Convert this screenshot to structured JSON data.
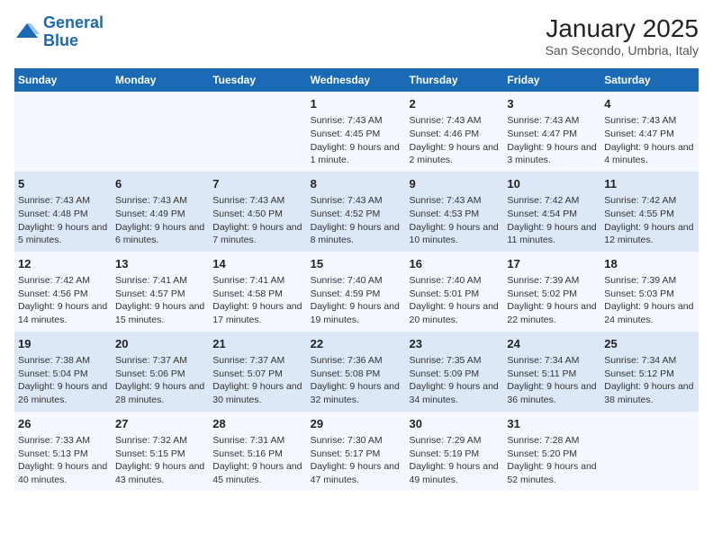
{
  "header": {
    "logo_line1": "General",
    "logo_line2": "Blue",
    "month": "January 2025",
    "location": "San Secondo, Umbria, Italy"
  },
  "weekdays": [
    "Sunday",
    "Monday",
    "Tuesday",
    "Wednesday",
    "Thursday",
    "Friday",
    "Saturday"
  ],
  "weeks": [
    [
      {
        "day": "",
        "info": ""
      },
      {
        "day": "",
        "info": ""
      },
      {
        "day": "",
        "info": ""
      },
      {
        "day": "1",
        "info": "Sunrise: 7:43 AM\nSunset: 4:45 PM\nDaylight: 9 hours and 1 minute."
      },
      {
        "day": "2",
        "info": "Sunrise: 7:43 AM\nSunset: 4:46 PM\nDaylight: 9 hours and 2 minutes."
      },
      {
        "day": "3",
        "info": "Sunrise: 7:43 AM\nSunset: 4:47 PM\nDaylight: 9 hours and 3 minutes."
      },
      {
        "day": "4",
        "info": "Sunrise: 7:43 AM\nSunset: 4:47 PM\nDaylight: 9 hours and 4 minutes."
      }
    ],
    [
      {
        "day": "5",
        "info": "Sunrise: 7:43 AM\nSunset: 4:48 PM\nDaylight: 9 hours and 5 minutes."
      },
      {
        "day": "6",
        "info": "Sunrise: 7:43 AM\nSunset: 4:49 PM\nDaylight: 9 hours and 6 minutes."
      },
      {
        "day": "7",
        "info": "Sunrise: 7:43 AM\nSunset: 4:50 PM\nDaylight: 9 hours and 7 minutes."
      },
      {
        "day": "8",
        "info": "Sunrise: 7:43 AM\nSunset: 4:52 PM\nDaylight: 9 hours and 8 minutes."
      },
      {
        "day": "9",
        "info": "Sunrise: 7:43 AM\nSunset: 4:53 PM\nDaylight: 9 hours and 10 minutes."
      },
      {
        "day": "10",
        "info": "Sunrise: 7:42 AM\nSunset: 4:54 PM\nDaylight: 9 hours and 11 minutes."
      },
      {
        "day": "11",
        "info": "Sunrise: 7:42 AM\nSunset: 4:55 PM\nDaylight: 9 hours and 12 minutes."
      }
    ],
    [
      {
        "day": "12",
        "info": "Sunrise: 7:42 AM\nSunset: 4:56 PM\nDaylight: 9 hours and 14 minutes."
      },
      {
        "day": "13",
        "info": "Sunrise: 7:41 AM\nSunset: 4:57 PM\nDaylight: 9 hours and 15 minutes."
      },
      {
        "day": "14",
        "info": "Sunrise: 7:41 AM\nSunset: 4:58 PM\nDaylight: 9 hours and 17 minutes."
      },
      {
        "day": "15",
        "info": "Sunrise: 7:40 AM\nSunset: 4:59 PM\nDaylight: 9 hours and 19 minutes."
      },
      {
        "day": "16",
        "info": "Sunrise: 7:40 AM\nSunset: 5:01 PM\nDaylight: 9 hours and 20 minutes."
      },
      {
        "day": "17",
        "info": "Sunrise: 7:39 AM\nSunset: 5:02 PM\nDaylight: 9 hours and 22 minutes."
      },
      {
        "day": "18",
        "info": "Sunrise: 7:39 AM\nSunset: 5:03 PM\nDaylight: 9 hours and 24 minutes."
      }
    ],
    [
      {
        "day": "19",
        "info": "Sunrise: 7:38 AM\nSunset: 5:04 PM\nDaylight: 9 hours and 26 minutes."
      },
      {
        "day": "20",
        "info": "Sunrise: 7:37 AM\nSunset: 5:06 PM\nDaylight: 9 hours and 28 minutes."
      },
      {
        "day": "21",
        "info": "Sunrise: 7:37 AM\nSunset: 5:07 PM\nDaylight: 9 hours and 30 minutes."
      },
      {
        "day": "22",
        "info": "Sunrise: 7:36 AM\nSunset: 5:08 PM\nDaylight: 9 hours and 32 minutes."
      },
      {
        "day": "23",
        "info": "Sunrise: 7:35 AM\nSunset: 5:09 PM\nDaylight: 9 hours and 34 minutes."
      },
      {
        "day": "24",
        "info": "Sunrise: 7:34 AM\nSunset: 5:11 PM\nDaylight: 9 hours and 36 minutes."
      },
      {
        "day": "25",
        "info": "Sunrise: 7:34 AM\nSunset: 5:12 PM\nDaylight: 9 hours and 38 minutes."
      }
    ],
    [
      {
        "day": "26",
        "info": "Sunrise: 7:33 AM\nSunset: 5:13 PM\nDaylight: 9 hours and 40 minutes."
      },
      {
        "day": "27",
        "info": "Sunrise: 7:32 AM\nSunset: 5:15 PM\nDaylight: 9 hours and 43 minutes."
      },
      {
        "day": "28",
        "info": "Sunrise: 7:31 AM\nSunset: 5:16 PM\nDaylight: 9 hours and 45 minutes."
      },
      {
        "day": "29",
        "info": "Sunrise: 7:30 AM\nSunset: 5:17 PM\nDaylight: 9 hours and 47 minutes."
      },
      {
        "day": "30",
        "info": "Sunrise: 7:29 AM\nSunset: 5:19 PM\nDaylight: 9 hours and 49 minutes."
      },
      {
        "day": "31",
        "info": "Sunrise: 7:28 AM\nSunset: 5:20 PM\nDaylight: 9 hours and 52 minutes."
      },
      {
        "day": "",
        "info": ""
      }
    ]
  ]
}
